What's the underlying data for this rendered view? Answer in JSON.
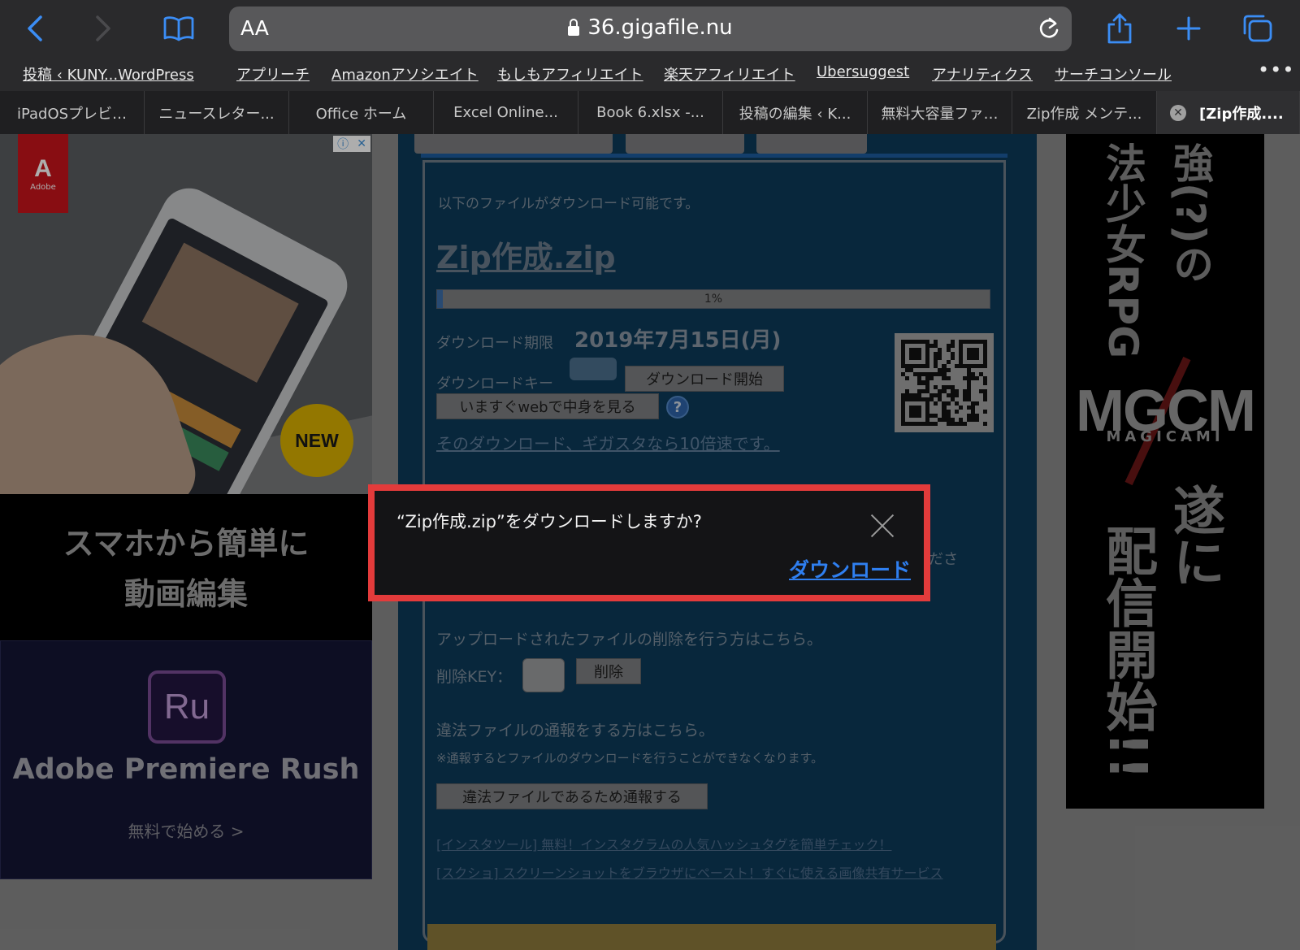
{
  "browser": {
    "reader_label": "AA",
    "url": "36.gigafile.nu",
    "icons": {
      "back": "chevron-left-icon",
      "forward": "chevron-right-icon",
      "bookmarks": "book-icon",
      "reload": "reload-icon",
      "share": "share-icon",
      "new_tab": "plus-icon",
      "tabs": "tabs-icon"
    },
    "accent": "#2f7ff0"
  },
  "bookmarks": [
    "投稿 ‹ KUNY...WordPress",
    "アプリーチ",
    "Amazonアソシエイト",
    "もしもアフィリエイト",
    "楽天アフィリエイト",
    "Ubersuggest",
    "アナリティクス",
    "サーチコンソール"
  ],
  "bookmarks_more": "•••",
  "tabs": [
    "iPadOSプレビ…",
    "ニュースレター...",
    "Office ホーム",
    "Excel Online...",
    "Book 6.xlsx -...",
    "投稿の編集 ‹ K...",
    "無料大容量ファ…",
    "Zip作成 メンテ...",
    "[Zip作成...."
  ],
  "left_ad": {
    "logo_text": "Adobe",
    "new_badge": "NEW",
    "headline_line1": "スマホから簡単に",
    "headline_line2": "動画編集",
    "product_logo": "Ru",
    "product_name": "Adobe Premiere Rush",
    "cta": "無料で始める >"
  },
  "download": {
    "available_text": "以下のファイルがダウンロード可能です。",
    "file_name": "Zip作成.zip",
    "progress_percent": 1,
    "progress_label": "1%",
    "expiry_label": "ダウンロード期限",
    "expiry_date": "2019年7月15日(月)",
    "key_label": "ダウンロードキー",
    "start_button": "ダウンロード開始",
    "web_view_button": "いますぐwebで中身を見る",
    "help_symbol": "?",
    "gigasta_link": "そのダウンロード、ギガスタなら10倍速です。",
    "partial_text": "ださ",
    "delete_info": "アップロードされたファイルの削除を行う方はこちら。",
    "delete_key_label": "削除KEY：",
    "delete_button": "削除",
    "report_info": "違法ファイルの通報をする方はこちら。",
    "report_note": "※通報するとファイルのダウンロードを行うことができなくなります。",
    "report_button": "違法ファイルであるため通報する",
    "link1": "[インスタツール] 無料！インスタグラムの人気ハッシュタグを簡単チェック！",
    "link2": "[スクショ] スクリーンショットをブラウザにペースト！すぐに使える画像共有サービス"
  },
  "right_ad": {
    "top_text_1": "法少女RPG",
    "top_text_2": "強(?)の",
    "logo": "MGCM",
    "logo_sub": "MAGICAMI",
    "bottom_text_1": "配信開始!!",
    "bottom_text_2": "遂に"
  },
  "dialog": {
    "message": "“Zip作成.zip”をダウンロードしますか?",
    "download_label": "ダウンロード",
    "border_color": "#e33b3b"
  }
}
